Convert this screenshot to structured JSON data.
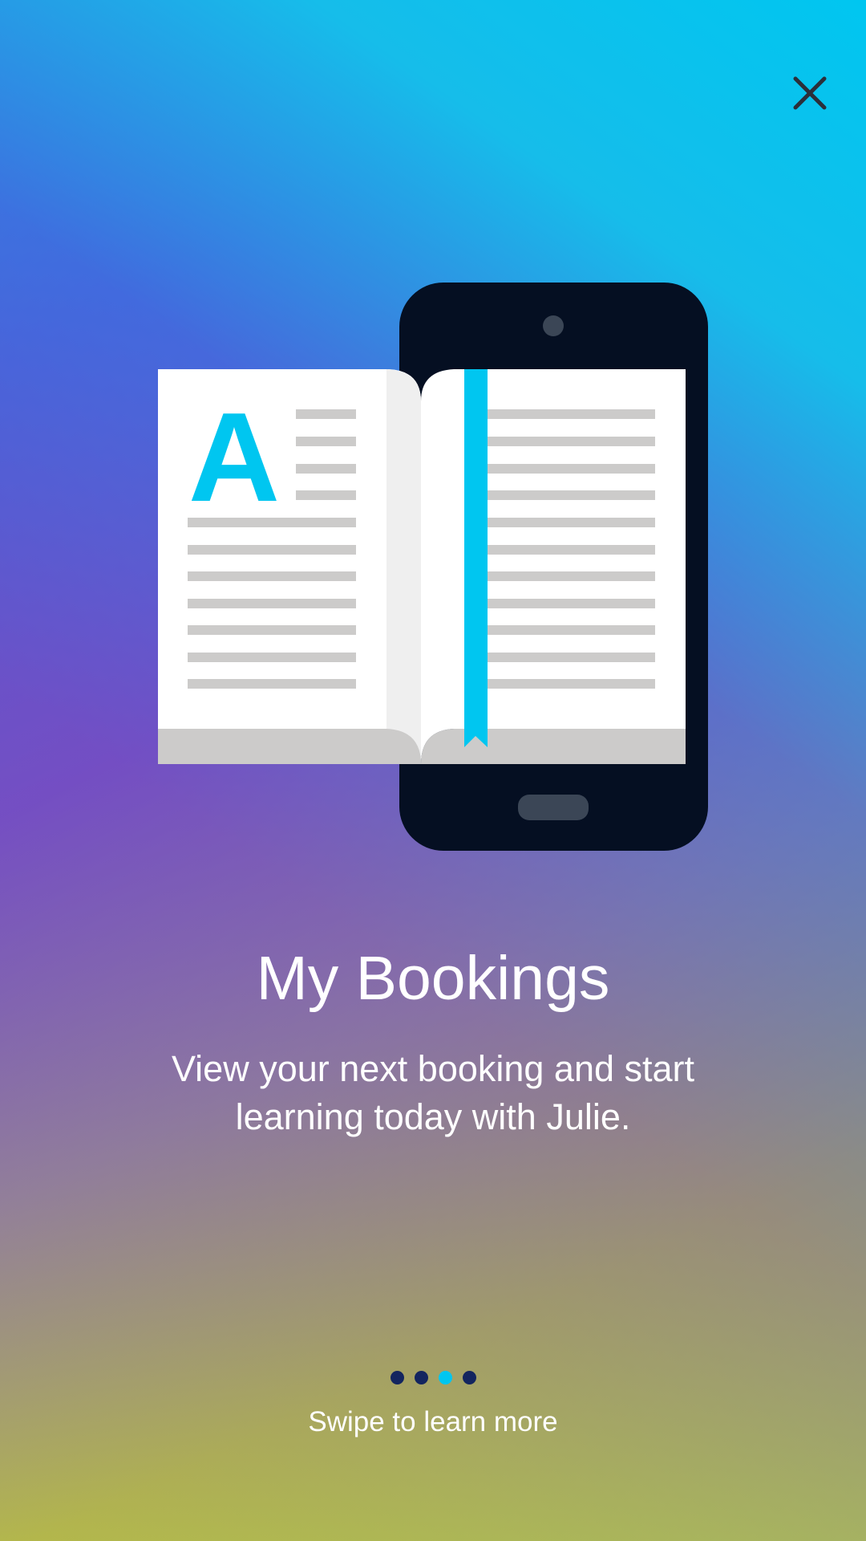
{
  "onboarding": {
    "title": "My Bookings",
    "description": "View your next booking and start learning today with Julie.",
    "swipe_hint": "Swipe to learn more",
    "close_icon": "close-icon",
    "illustration": "book-and-phone-illustration",
    "illustration_letter": "A",
    "pager": {
      "total": 4,
      "active_index": 2
    }
  },
  "colors": {
    "accent": "#00c6f0",
    "phone_body": "#050f22",
    "dot_inactive": "#13255f",
    "dot_active": "#00c6f0"
  }
}
